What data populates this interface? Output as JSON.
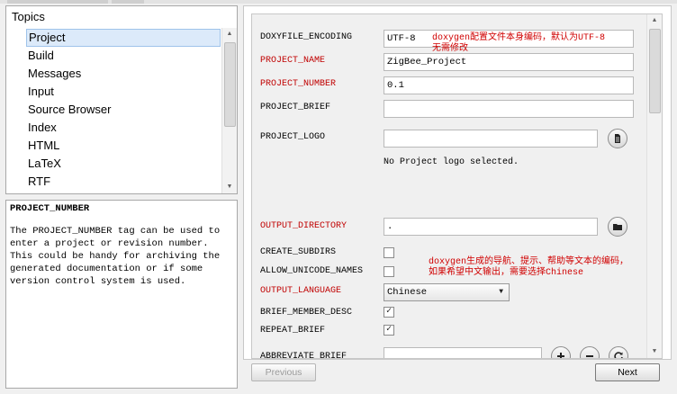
{
  "topics": {
    "header": "Topics",
    "items": [
      "Project",
      "Build",
      "Messages",
      "Input",
      "Source Browser",
      "Index",
      "HTML",
      "LaTeX",
      "RTF"
    ],
    "selected_index": 0
  },
  "help": {
    "title": "PROJECT_NUMBER",
    "text": "The PROJECT_NUMBER tag can be used to enter a project or revision number. This could be handy for archiving the generated documentation or if some version control system is used."
  },
  "settings": {
    "doxyfile_encoding": {
      "label": "DOXYFILE_ENCODING",
      "value": "UTF-8"
    },
    "project_name": {
      "label": "PROJECT_NAME",
      "value": "ZigBee_Project"
    },
    "project_number": {
      "label": "PROJECT_NUMBER",
      "value": "0.1"
    },
    "project_brief": {
      "label": "PROJECT_BRIEF",
      "value": ""
    },
    "project_logo": {
      "label": "PROJECT_LOGO",
      "value": "",
      "status": "No Project logo selected."
    },
    "output_directory": {
      "label": "OUTPUT_DIRECTORY",
      "value": "."
    },
    "create_subdirs": {
      "label": "CREATE_SUBDIRS",
      "checked": false
    },
    "allow_unicode_names": {
      "label": "ALLOW_UNICODE_NAMES",
      "checked": false
    },
    "output_language": {
      "label": "OUTPUT_LANGUAGE",
      "value": "Chinese"
    },
    "brief_member_desc": {
      "label": "BRIEF_MEMBER_DESC",
      "checked": true
    },
    "repeat_brief": {
      "label": "REPEAT_BRIEF",
      "checked": true
    },
    "abbreviate_brief": {
      "label": "ABBREVIATE_BRIEF",
      "value": ""
    }
  },
  "notes": {
    "encoding_line1": "doxygen配置文件本身编码，默认为UTF-8",
    "encoding_line2": "无需修改",
    "language_line1": "doxygen生成的导航、提示、帮助等文本的编码，",
    "language_line2": "如果希望中文输出，需要选择Chinese"
  },
  "buttons": {
    "previous": "Previous",
    "next": "Next"
  },
  "icons": {
    "browse_file": "file-icon",
    "browse_folder": "folder-icon",
    "add": "plus-icon",
    "remove": "minus-icon",
    "reset": "refresh-icon"
  },
  "colors": {
    "required_label": "#c00000",
    "annotation": "#d00000"
  }
}
